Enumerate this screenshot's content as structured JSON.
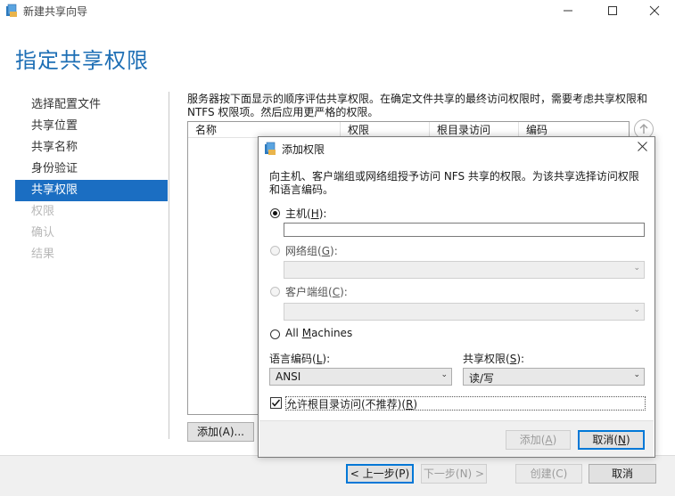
{
  "window": {
    "title": "新建共享向导",
    "min_icon": "minimize-icon",
    "max_icon": "maximize-icon",
    "close_icon": "close-icon"
  },
  "page_heading": "指定共享权限",
  "nav": {
    "items": [
      {
        "label": "选择配置文件",
        "state": "normal"
      },
      {
        "label": "共享位置",
        "state": "normal"
      },
      {
        "label": "共享名称",
        "state": "normal"
      },
      {
        "label": "身份验证",
        "state": "normal"
      },
      {
        "label": "共享权限",
        "state": "active"
      },
      {
        "label": "权限",
        "state": "disabled"
      },
      {
        "label": "确认",
        "state": "disabled"
      },
      {
        "label": "结果",
        "state": "disabled"
      }
    ]
  },
  "description": "服务器按下面显示的顺序评估共享权限。在确定文件共享的最终访问权限时，需要考虑共享权限和 NTFS 权限项。然后应用更严格的权限。",
  "permissions_table": {
    "columns": [
      "名称",
      "权限",
      "根目录访问",
      "编码"
    ]
  },
  "buttons": {
    "add": "添加(A)...",
    "prev": "< 上一步(P)",
    "next": "下一步(N) >",
    "create": "创建(C)",
    "cancel": "取消"
  },
  "dialog": {
    "title": "添加权限",
    "description": "向主机、客户端组或网络组授予访问 NFS 共享的权限。为该共享选择访问权限和语言编码。",
    "options": {
      "host": {
        "label": "主机",
        "mnemonic": "H",
        "selected": true,
        "value": ""
      },
      "netgroup": {
        "label": "网络组",
        "mnemonic": "G",
        "selected": false
      },
      "client_group": {
        "label": "客户端组",
        "mnemonic": "C",
        "selected": false
      },
      "all_machines": {
        "label_pre": "All ",
        "mnemonic": "M",
        "label_post": "achines",
        "selected": false
      }
    },
    "encoding": {
      "label": "语言编码",
      "mnemonic": "L",
      "value": "ANSI"
    },
    "share_permission": {
      "label": "共享权限",
      "mnemonic": "S",
      "value": "读/写"
    },
    "root_access": {
      "label": "允许根目录访问(不推荐)",
      "mnemonic": "R",
      "checked": true
    },
    "buttons": {
      "add_pre": "添加(",
      "add_mnemonic": "A",
      "add_post": ")",
      "cancel_pre": "取消(",
      "cancel_mnemonic": "N",
      "cancel_post": ")"
    }
  },
  "colors": {
    "accent": "#1b6ec2",
    "heading": "#1e6fb5",
    "disabled_text": "#b8b8b8"
  }
}
